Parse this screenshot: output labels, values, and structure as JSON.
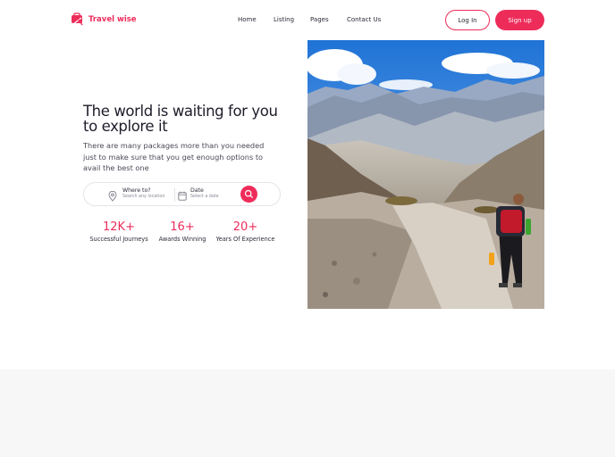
{
  "brand": {
    "name": "Travel wise",
    "accent": "#ee2c5a"
  },
  "nav": {
    "items": [
      "Home",
      "Listing",
      "Pages",
      "Contact Us"
    ]
  },
  "auth": {
    "login_label": "Log In",
    "signup_label": "Sign up"
  },
  "hero": {
    "title": "The world is waiting for you to explore it",
    "subtitle": "There are many packages more than you needed just to make sure that you get enough options to avail the best one"
  },
  "search": {
    "location": {
      "label": "Where to?",
      "hint": "Search any location",
      "icon": "map-pin-icon"
    },
    "date": {
      "label": "Date",
      "hint": "Select a date",
      "icon": "calendar-icon"
    },
    "button_icon": "search-icon"
  },
  "stats": [
    {
      "value": "12K+",
      "label": "Successful Journeys"
    },
    {
      "value": "16+",
      "label": "Awards Winning"
    },
    {
      "value": "20+",
      "label": "Years Of Experience"
    }
  ],
  "hero_image": {
    "subject": "hiker-on-mountain-trail"
  }
}
